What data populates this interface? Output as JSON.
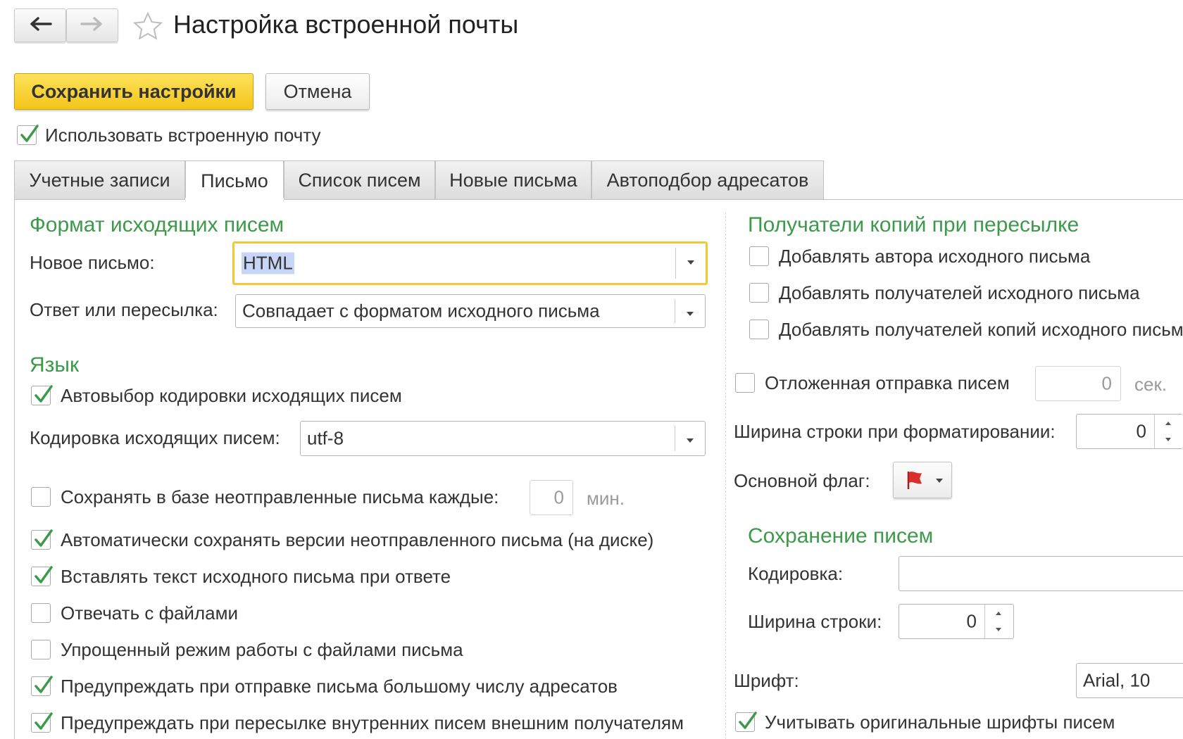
{
  "window": {
    "title": "Настройка встроенной почты"
  },
  "toolbar": {
    "save_label": "Сохранить настройки",
    "cancel_label": "Отмена"
  },
  "use_builtin_mail": {
    "label": "Использовать встроенную почту",
    "checked": true
  },
  "tabs": [
    {
      "label": "Учетные записи",
      "active": false
    },
    {
      "label": "Письмо",
      "active": true
    },
    {
      "label": "Список писем",
      "active": false
    },
    {
      "label": "Новые письма",
      "active": false
    },
    {
      "label": "Автоподбор адресатов",
      "active": false
    }
  ],
  "left": {
    "format_section": "Формат исходящих писем",
    "new_letter": {
      "label": "Новое письмо:",
      "value": "HTML"
    },
    "reply_forward": {
      "label": "Ответ или пересылка:",
      "value": "Совпадает с форматом исходного письма"
    },
    "language_section": "Язык",
    "auto_encoding": {
      "label": "Автовыбор кодировки исходящих писем",
      "checked": true
    },
    "encoding": {
      "label": "Кодировка исходящих писем:",
      "value": "utf-8"
    },
    "save_unsent": {
      "label": "Сохранять в базе неотправленные письма каждые:",
      "value": "0",
      "unit": "мин.",
      "checked": false
    },
    "options": [
      {
        "label": "Автоматически сохранять версии неотправленного письма (на диске)",
        "checked": true
      },
      {
        "label": "Вставлять текст исходного письма при ответе",
        "checked": true
      },
      {
        "label": "Отвечать с файлами",
        "checked": false
      },
      {
        "label": "Упрощенный режим работы с файлами письма",
        "checked": false
      },
      {
        "label": "Предупреждать при отправке письма большому числу адресатов",
        "checked": true
      },
      {
        "label": "Предупреждать при пересылке внутренних писем внешним получателям",
        "checked": true
      }
    ]
  },
  "right": {
    "copies_section": "Получатели копий при пересылке",
    "copies": [
      {
        "label": "Добавлять автора исходного письма",
        "checked": false
      },
      {
        "label": "Добавлять получателей исходного письма",
        "checked": false
      },
      {
        "label": "Добавлять получателей копий исходного письма",
        "checked": false
      }
    ],
    "delayed": {
      "label": "Отложенная отправка писем",
      "value": "0",
      "unit": "сек.",
      "checked": false
    },
    "line_width_format": {
      "label": "Ширина строки при форматировании:",
      "value": "0"
    },
    "main_flag": {
      "label": "Основной флаг:",
      "flag_color": "#d9302c"
    },
    "saving_section": "Сохранение писем",
    "save_encoding": {
      "label": "Кодировка:",
      "value": ""
    },
    "save_line_width": {
      "label": "Ширина строки:",
      "value": "0"
    },
    "font": {
      "label": "Шрифт:",
      "value": "Arial, 10"
    },
    "original_fonts": {
      "label": "Учитывать оригинальные шрифты писем",
      "checked": true
    }
  },
  "colors": {
    "accent_green": "#3c9a4a",
    "save_yellow": "#f7cf2a",
    "focus_yellow": "#f0c93a"
  }
}
